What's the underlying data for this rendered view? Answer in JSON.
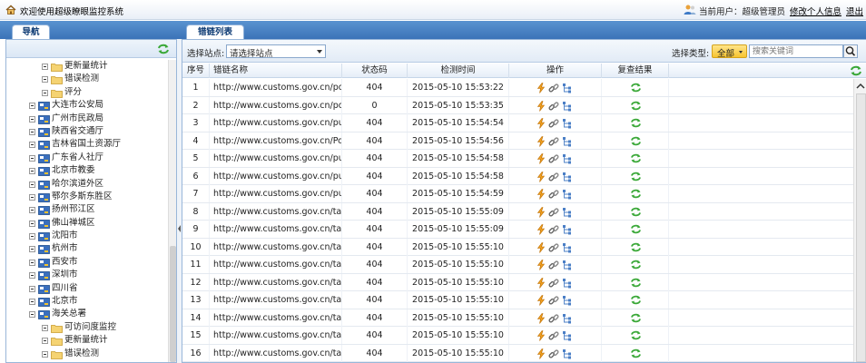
{
  "app": {
    "title": "欢迎使用超级瞭眼监控系统",
    "current_user_label": "当前用户：",
    "current_user": "超级管理员",
    "edit_profile": "修改个人信息",
    "logout": "退出"
  },
  "nav": {
    "tab_label": "导航",
    "tree": [
      {
        "label": "更新量统计",
        "type": "folder",
        "level": 2
      },
      {
        "label": "错误检测",
        "type": "folder",
        "level": 2
      },
      {
        "label": "评分",
        "type": "folder",
        "level": 2
      },
      {
        "label": "大连市公安局",
        "type": "site",
        "level": 1
      },
      {
        "label": "广州市民政局",
        "type": "site",
        "level": 1
      },
      {
        "label": "陕西省交通厅",
        "type": "site",
        "level": 1
      },
      {
        "label": "吉林省国土资源厅",
        "type": "site",
        "level": 1
      },
      {
        "label": "广东省人社厅",
        "type": "site",
        "level": 1
      },
      {
        "label": "北京市教委",
        "type": "site",
        "level": 1
      },
      {
        "label": "哈尔滨道外区",
        "type": "site",
        "level": 1
      },
      {
        "label": "鄂尔多斯东胜区",
        "type": "site",
        "level": 1
      },
      {
        "label": "扬州邗江区",
        "type": "site",
        "level": 1
      },
      {
        "label": "佛山禅城区",
        "type": "site",
        "level": 1
      },
      {
        "label": "沈阳市",
        "type": "site",
        "level": 1
      },
      {
        "label": "杭州市",
        "type": "site",
        "level": 1
      },
      {
        "label": "西安市",
        "type": "site",
        "level": 1
      },
      {
        "label": "深圳市",
        "type": "site",
        "level": 1
      },
      {
        "label": "四川省",
        "type": "site",
        "level": 1
      },
      {
        "label": "北京市",
        "type": "site",
        "level": 1
      },
      {
        "label": "海关总署",
        "type": "site",
        "level": 1
      },
      {
        "label": "可访问度监控",
        "type": "folder",
        "level": 2
      },
      {
        "label": "更新量统计",
        "type": "folder",
        "level": 2
      },
      {
        "label": "错误检测",
        "type": "folder",
        "level": 2
      }
    ]
  },
  "main": {
    "tab_label": "错链列表",
    "site_select_label": "选择站点:",
    "site_select_value": "请选择站点",
    "type_select_label": "选择类型:",
    "type_select_value": "全部",
    "search_placeholder": "搜索关键词",
    "columns": [
      "序号",
      "错链名称",
      "状态码",
      "检测时间",
      "操作",
      "复查结果"
    ],
    "rows": [
      {
        "no": "1",
        "name": "http://www.customs.gov.cn/portal...",
        "code": "404",
        "time": "2015-05-10 15:53:22"
      },
      {
        "no": "2",
        "name": "http://www.customs.gov.cn/portal...",
        "code": "0",
        "time": "2015-05-10 15:53:35"
      },
      {
        "no": "3",
        "name": "http://www.customs.gov.cn/publis...",
        "code": "404",
        "time": "2015-05-10 15:54:54"
      },
      {
        "no": "4",
        "name": "http://www.customs.gov.cn/Portal...",
        "code": "404",
        "time": "2015-05-10 15:54:56"
      },
      {
        "no": "5",
        "name": "http://www.customs.gov.cn/publis...",
        "code": "404",
        "time": "2015-05-10 15:54:58"
      },
      {
        "no": "6",
        "name": "http://www.customs.gov.cn/publis...",
        "code": "404",
        "time": "2015-05-10 15:54:58"
      },
      {
        "no": "7",
        "name": "http://www.customs.gov.cn/publis...",
        "code": "404",
        "time": "2015-05-10 15:54:59"
      },
      {
        "no": "8",
        "name": "http://www.customs.gov.cn/tabid/...",
        "code": "404",
        "time": "2015-05-10 15:55:09"
      },
      {
        "no": "9",
        "name": "http://www.customs.gov.cn/tabid/...",
        "code": "404",
        "time": "2015-05-10 15:55:09"
      },
      {
        "no": "10",
        "name": "http://www.customs.gov.cn/tabid/...",
        "code": "404",
        "time": "2015-05-10 15:55:10"
      },
      {
        "no": "11",
        "name": "http://www.customs.gov.cn/tabid/...",
        "code": "404",
        "time": "2015-05-10 15:55:10"
      },
      {
        "no": "12",
        "name": "http://www.customs.gov.cn/tabid/...",
        "code": "404",
        "time": "2015-05-10 15:55:10"
      },
      {
        "no": "13",
        "name": "http://www.customs.gov.cn/tabid/...",
        "code": "404",
        "time": "2015-05-10 15:55:10"
      },
      {
        "no": "14",
        "name": "http://www.customs.gov.cn/tabid/...",
        "code": "404",
        "time": "2015-05-10 15:55:10"
      },
      {
        "no": "15",
        "name": "http://www.customs.gov.cn/tabid/...",
        "code": "404",
        "time": "2015-05-10 15:55:10"
      },
      {
        "no": "16",
        "name": "http://www.customs.gov.cn/tabid/...",
        "code": "404",
        "time": "2015-05-10 15:55:10"
      }
    ]
  },
  "icons": {
    "home": "home-icon",
    "user": "user-icon",
    "refresh": "refresh-icon",
    "folder": "folder-icon",
    "site": "site-icon",
    "search": "search-icon",
    "op_edit": "lightning-icon",
    "op_link": "link-icon",
    "op_tree": "tree-icon",
    "recheck": "recheck-icon"
  },
  "colors": {
    "band": "#3b73b8",
    "tab_text": "#0c3a73",
    "type_select": "#f7c430",
    "refresh": "#3aa838"
  }
}
